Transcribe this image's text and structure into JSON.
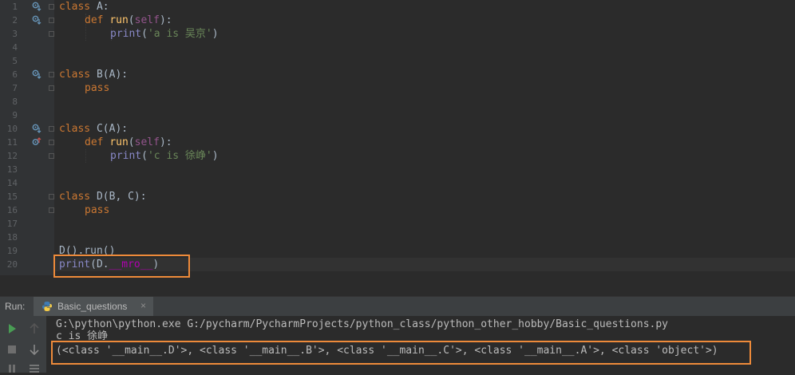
{
  "editor": {
    "line_numbers": [
      "1",
      "2",
      "3",
      "4",
      "5",
      "6",
      "7",
      "8",
      "9",
      "10",
      "11",
      "12",
      "13",
      "14",
      "15",
      "16",
      "17",
      "18",
      "19",
      "20"
    ],
    "code": {
      "l1": {
        "kw": "class",
        "rest": " A:"
      },
      "l2": {
        "kw": "def",
        "fn": "run",
        "p1": "(",
        "self": "self",
        "p2": "):"
      },
      "l3": {
        "bi": "print",
        "p1": "(",
        "str": "'a is 吴京'",
        "p2": ")"
      },
      "l6": {
        "kw": "class",
        "rest": " B(A):"
      },
      "l7": {
        "kw": "pass"
      },
      "l10": {
        "kw": "class",
        "rest": " C(A):"
      },
      "l11": {
        "kw": "def",
        "fn": "run",
        "p1": "(",
        "self": "self",
        "p2": "):"
      },
      "l12": {
        "bi": "print",
        "p1": "(",
        "str": "'c is 徐峥'",
        "p2": ")"
      },
      "l15": {
        "kw": "class",
        "rest": " D(B, C):"
      },
      "l16": {
        "kw": "pass"
      },
      "l19": {
        "text": "D().run()"
      },
      "l20": {
        "bi": "print",
        "p1": "(D.",
        "magic": "__mro__",
        "p2": ")"
      }
    }
  },
  "run_panel": {
    "label": "Run:",
    "tab_title": "Basic_questions",
    "tab_close": "×",
    "output": [
      "G:\\python\\python.exe G:/pycharm/PycharmProjects/python_class/python_other_hobby/Basic_questions.py",
      "c is 徐峥",
      "(<class '__main__.D'>, <class '__main__.B'>, <class '__main__.C'>, <class '__main__.A'>, <class 'object'>)"
    ]
  },
  "colors": {
    "highlight_box": "#ed8a3a",
    "keyword": "#cc7832",
    "string": "#6a8759",
    "builtin": "#8888c6"
  }
}
